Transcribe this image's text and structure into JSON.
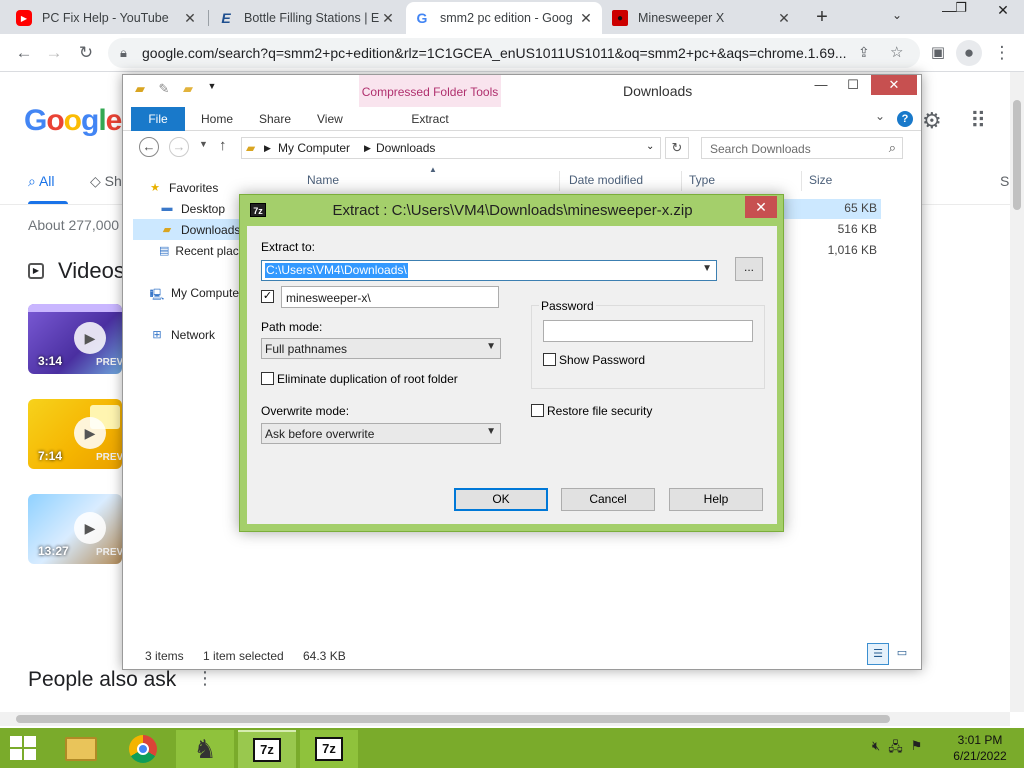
{
  "browser": {
    "tabs": [
      {
        "title": "PC Fix Help - YouTube",
        "icon": "youtube-icon"
      },
      {
        "title": "Bottle Filling Stations | Elk",
        "icon": "elkay-icon"
      },
      {
        "title": "smm2 pc edition - Goog",
        "icon": "google-icon"
      },
      {
        "title": "Minesweeper X",
        "icon": "minesweeper-icon"
      }
    ],
    "url": "google.com/search?q=smm2+pc+edition&rlz=1C1GCEA_enUS1011US1011&oq=smm2+pc+&aqs=chrome.1.69..."
  },
  "google": {
    "logo": "Google",
    "tab_all": "All",
    "tab_shopping": "Sh",
    "tab_s": "S",
    "about": "About 277,000",
    "videos_heading": "Videos",
    "videos": [
      {
        "duration": "3:14",
        "badge": "PREV"
      },
      {
        "duration": "7:14",
        "badge": "PREV"
      },
      {
        "duration": "13:27",
        "badge": "PREV"
      }
    ],
    "people_also_ask": "People also ask"
  },
  "explorer": {
    "title": "Downloads",
    "context_tab": "Compressed Folder Tools",
    "ribbon_tabs": [
      "File",
      "Home",
      "Share",
      "View",
      "Extract"
    ],
    "path": [
      "My Computer",
      "Downloads"
    ],
    "search_placeholder": "Search Downloads",
    "nav": {
      "favorites": "Favorites",
      "desktop": "Desktop",
      "downloads": "Downloads",
      "recent": "Recent places",
      "computer": "My Computer",
      "network": "Network"
    },
    "columns": {
      "name": "Name",
      "date": "Date modified",
      "type": "Type",
      "size": "Size"
    },
    "sizes": [
      "65 KB",
      "516 KB",
      "1,016 KB"
    ],
    "status": {
      "items": "3 items",
      "selected": "1 item selected",
      "selected_size": "64.3 KB"
    }
  },
  "dialog": {
    "icon_text": "7z",
    "title": "Extract : C:\\Users\\VM4\\Downloads\\minesweeper-x.zip",
    "extract_to_label": "Extract to:",
    "extract_path": "C:\\Users\\VM4\\Downloads\\",
    "browse": "...",
    "subfolder": "minesweeper-x\\",
    "subfolder_checked": true,
    "path_mode_label": "Path mode:",
    "path_mode": "Full pathnames",
    "eliminate_label": "Eliminate duplication of root folder",
    "overwrite_label": "Overwrite mode:",
    "overwrite_mode": "Ask before overwrite",
    "password_label": "Password",
    "password_value": "",
    "show_password": "Show Password",
    "restore_security": "Restore file security",
    "ok": "OK",
    "cancel": "Cancel",
    "help": "Help"
  },
  "taskbar": {
    "sevenzip_label": "7z",
    "time": "3:01 PM",
    "date": "6/21/2022"
  },
  "colors": {
    "taskbar": "#7aab2b",
    "dialog_frame": "#a4cf6b",
    "chrome_accent": "#1a73e8",
    "close_red": "#c75050"
  }
}
